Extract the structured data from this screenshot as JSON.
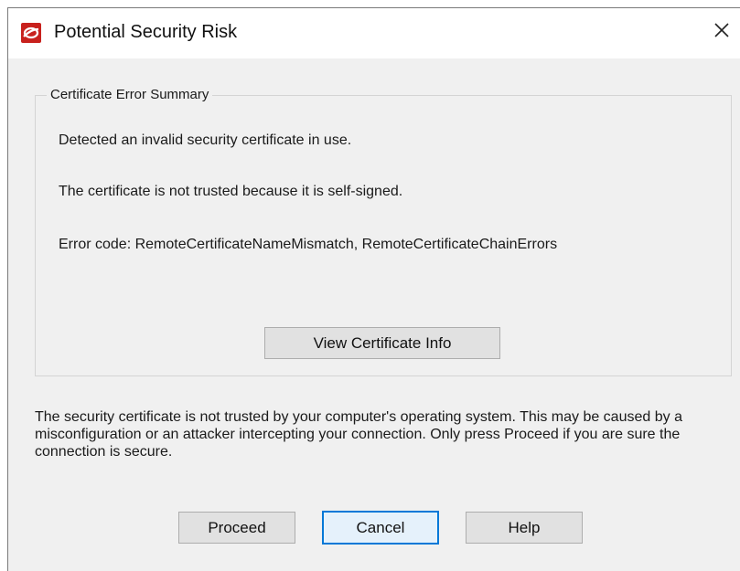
{
  "dialog": {
    "title": "Potential Security Risk",
    "close_symbol": "✕",
    "app_icon": "app-logo-icon",
    "accent_color": "#c8211d"
  },
  "summary": {
    "heading": "Certificate Error Summary",
    "lines": [
      "Detected an invalid security certificate in use.",
      "The certificate is not trusted because it is self-signed.",
      "Error code: RemoteCertificateNameMismatch, RemoteCertificateChainErrors"
    ],
    "view_button_label": "View Certificate Info"
  },
  "warning_text": "The security certificate is not trusted by your computer's operating system. This may be caused by a misconfiguration or an attacker intercepting your connection. Only press Proceed if you are sure the connection is secure.",
  "buttons": {
    "proceed": "Proceed",
    "cancel": "Cancel",
    "help": "Help"
  }
}
